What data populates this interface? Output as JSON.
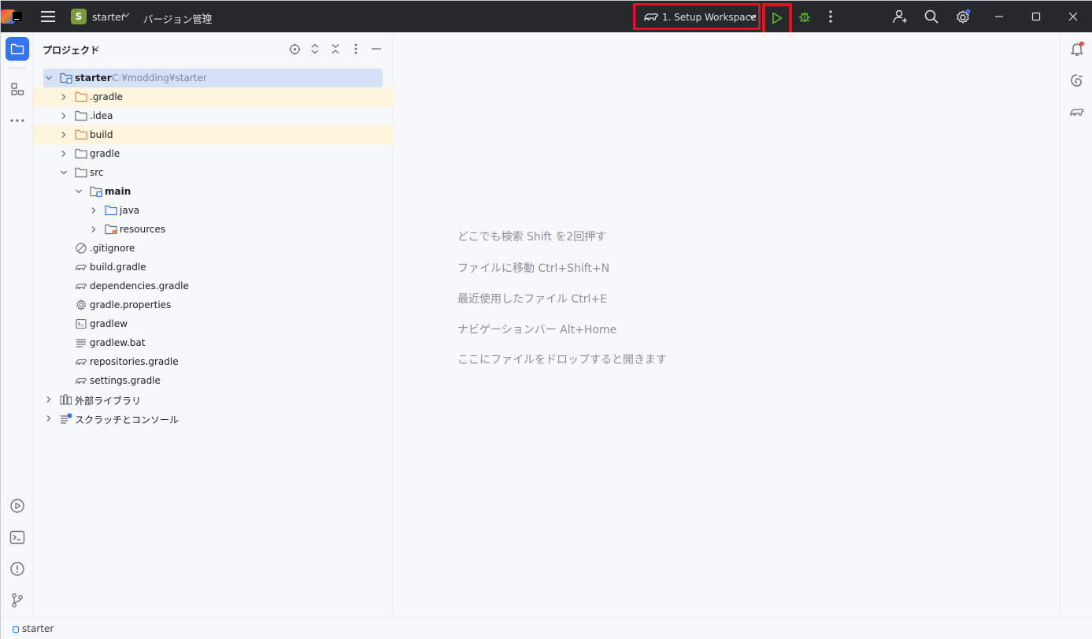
{
  "titlebar": {
    "project_badge": "S",
    "project_name": "starter",
    "vcs_menu": "バージョン管理",
    "run_config": "1. Setup Workspace"
  },
  "left_toolbar": {
    "icons": [
      "project-icon",
      "structure-icon",
      "more-icon",
      "run-icon",
      "terminal-icon",
      "problems-icon",
      "git-icon"
    ]
  },
  "panel": {
    "title": "プロジェクト",
    "tree": [
      {
        "label": "starter",
        "path": "C:¥modding¥starter",
        "depth": 0,
        "arrow": "open",
        "icon": "module-folder",
        "bold": true,
        "selected": true
      },
      {
        "label": ".gradle",
        "depth": 1,
        "arrow": "closed",
        "icon": "folder-excluded",
        "highlight": true
      },
      {
        "label": ".idea",
        "depth": 1,
        "arrow": "closed",
        "icon": "folder"
      },
      {
        "label": "build",
        "depth": 1,
        "arrow": "closed",
        "icon": "folder-excluded",
        "highlight": true
      },
      {
        "label": "gradle",
        "depth": 1,
        "arrow": "closed",
        "icon": "folder"
      },
      {
        "label": "src",
        "depth": 1,
        "arrow": "open",
        "icon": "folder"
      },
      {
        "label": "main",
        "depth": 2,
        "arrow": "open",
        "icon": "module-folder",
        "bold": true
      },
      {
        "label": "java",
        "depth": 3,
        "arrow": "closed",
        "icon": "source-folder"
      },
      {
        "label": "resources",
        "depth": 3,
        "arrow": "closed",
        "icon": "resources-folder"
      },
      {
        "label": ".gitignore",
        "depth": 1,
        "icon": "ignore-file"
      },
      {
        "label": "build.gradle",
        "depth": 1,
        "icon": "gradle-file"
      },
      {
        "label": "dependencies.gradle",
        "depth": 1,
        "icon": "gradle-file"
      },
      {
        "label": "gradle.properties",
        "depth": 1,
        "icon": "properties-file"
      },
      {
        "label": "gradlew",
        "depth": 1,
        "icon": "shell-file"
      },
      {
        "label": "gradlew.bat",
        "depth": 1,
        "icon": "text-file"
      },
      {
        "label": "repositories.gradle",
        "depth": 1,
        "icon": "gradle-file"
      },
      {
        "label": "settings.gradle",
        "depth": 1,
        "icon": "gradle-file"
      },
      {
        "label": "外部ライブラリ",
        "depth": 0,
        "arrow": "closed",
        "icon": "library"
      },
      {
        "label": "スクラッチとコンソール",
        "depth": 0,
        "arrow": "closed",
        "icon": "scratches"
      }
    ]
  },
  "editor": {
    "hints": [
      "どこでも検索 Shift を2回押す",
      "ファイルに移動 Ctrl+Shift+N",
      "最近使用したファイル Ctrl+E",
      "ナビゲーションバー Alt+Home",
      "ここにファイルをドロップすると開きます"
    ]
  },
  "statusbar": {
    "breadcrumb": "starter"
  },
  "colors": {
    "titlebar": "#27282c",
    "accent": "#3574f0",
    "highlight_box": "#e8101f",
    "selection": "#d5e1f7",
    "excluded_row": "#fdf5dc",
    "run_green": "#5fb832"
  }
}
